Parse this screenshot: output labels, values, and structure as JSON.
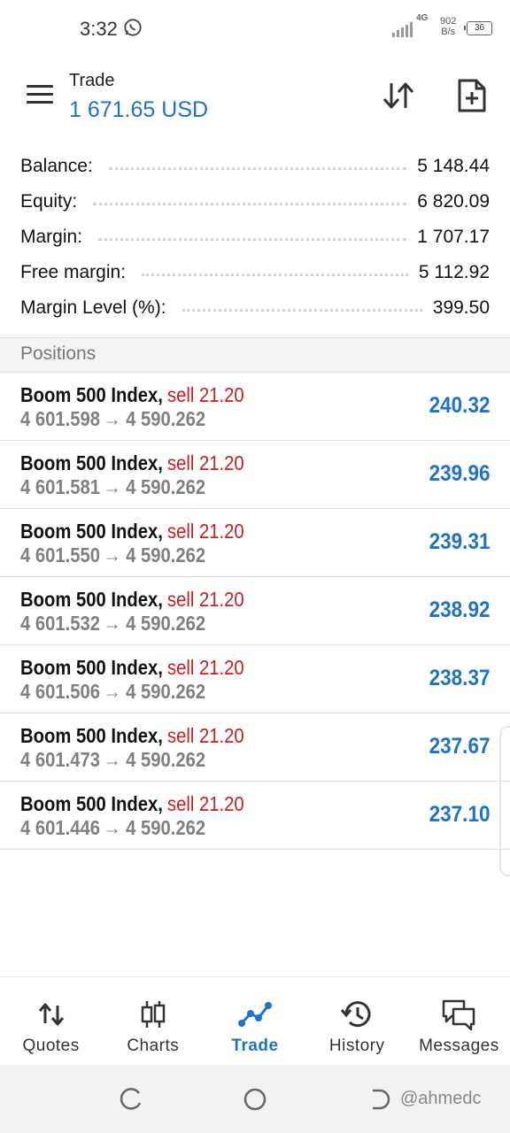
{
  "status_bar": {
    "time": "3:32",
    "network_type": "4G",
    "net_speed_value": "902",
    "net_speed_unit": "B/s",
    "battery_level": "36"
  },
  "header": {
    "title": "Trade",
    "balance_display": "1 671.65 USD"
  },
  "account": [
    {
      "label": "Balance:",
      "value": "5 148.44"
    },
    {
      "label": "Equity:",
      "value": "6 820.09"
    },
    {
      "label": "Margin:",
      "value": "1 707.17"
    },
    {
      "label": "Free margin:",
      "value": "5 112.92"
    },
    {
      "label": "Margin Level (%):",
      "value": "399.50"
    }
  ],
  "positions_header": "Positions",
  "positions": [
    {
      "symbol": "Boom 500 Index,",
      "side": "sell 21.20",
      "open_price": "4 601.598",
      "arrow": "→",
      "current_price": "4 590.262",
      "profit": "240.32"
    },
    {
      "symbol": "Boom 500 Index,",
      "side": "sell 21.20",
      "open_price": "4 601.581",
      "arrow": "→",
      "current_price": "4 590.262",
      "profit": "239.96"
    },
    {
      "symbol": "Boom 500 Index,",
      "side": "sell 21.20",
      "open_price": "4 601.550",
      "arrow": "→",
      "current_price": "4 590.262",
      "profit": "239.31"
    },
    {
      "symbol": "Boom 500 Index,",
      "side": "sell 21.20",
      "open_price": "4 601.532",
      "arrow": "→",
      "current_price": "4 590.262",
      "profit": "238.92"
    },
    {
      "symbol": "Boom 500 Index,",
      "side": "sell 21.20",
      "open_price": "4 601.506",
      "arrow": "→",
      "current_price": "4 590.262",
      "profit": "238.37"
    },
    {
      "symbol": "Boom 500 Index,",
      "side": "sell 21.20",
      "open_price": "4 601.473",
      "arrow": "→",
      "current_price": "4 590.262",
      "profit": "237.67"
    },
    {
      "symbol": "Boom 500 Index,",
      "side": "sell 21.20",
      "open_price": "4 601.446",
      "arrow": "→",
      "current_price": "4 590.262",
      "profit": "237.10"
    }
  ],
  "bottom_nav": [
    {
      "label": "Quotes",
      "icon": "quotes-icon"
    },
    {
      "label": "Charts",
      "icon": "candlestick-chart-icon"
    },
    {
      "label": "Trade",
      "icon": "trade-line-icon",
      "active": true
    },
    {
      "label": "History",
      "icon": "history-icon"
    },
    {
      "label": "Messages",
      "icon": "messages-icon"
    }
  ],
  "watermark": "@ahmedc",
  "colors": {
    "accent_blue": "#1e73c8",
    "sell_red": "#c81e1e",
    "muted_gray": "#808080"
  }
}
